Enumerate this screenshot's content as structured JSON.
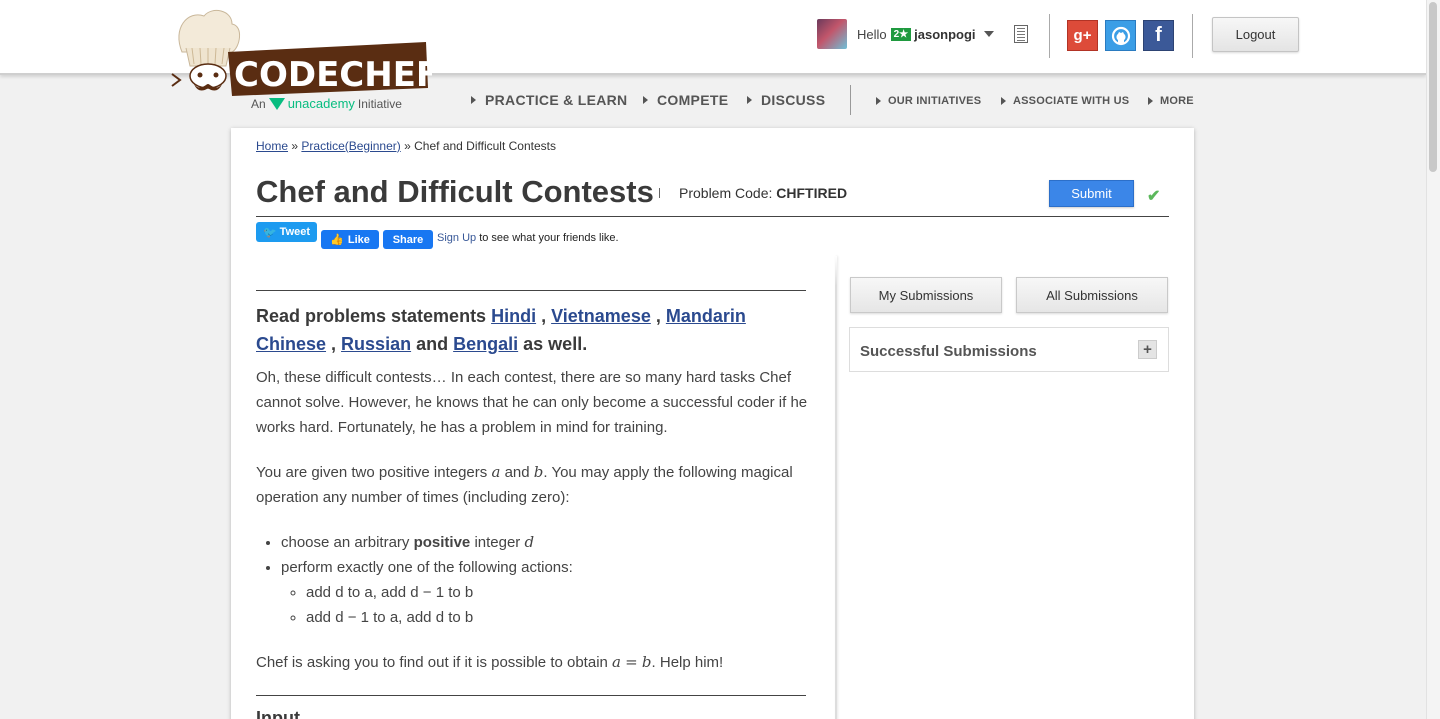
{
  "header": {
    "logo_text": "CODECHEF",
    "tagline_prefix": "An",
    "tagline_brand": "unacademy",
    "tagline_suffix": "Initiative",
    "greeting": "Hello",
    "star_badge": "2★",
    "username": "jasonpogi",
    "logout_label": "Logout",
    "social": [
      "google-plus-icon",
      "github-icon",
      "facebook-icon"
    ]
  },
  "nav": {
    "main": [
      "PRACTICE & LEARN",
      "COMPETE",
      "DISCUSS"
    ],
    "secondary": [
      "OUR INITIATIVES",
      "ASSOCIATE WITH US",
      "MORE"
    ]
  },
  "breadcrumb": {
    "home": "Home",
    "sep": "»",
    "practice": "Practice(Beginner)",
    "current": "Chef and Difficult Contests"
  },
  "problem": {
    "title": "Chef and Difficult Contests",
    "code_label": "Problem Code:",
    "code": "CHFTIRED",
    "submit_label": "Submit"
  },
  "share": {
    "tweet": "Tweet",
    "like": "Like",
    "share": "Share",
    "signup": "Sign Up",
    "signup_rest": "to see what your friends like."
  },
  "statement": {
    "read_prefix": "Read problems statements",
    "languages": [
      "Hindi",
      "Vietnamese",
      "Mandarin Chinese",
      "Russian",
      "Bengali"
    ],
    "and": "and",
    "read_suffix": "as well.",
    "para1": "Oh, these difficult contests… In each contest, there are so many hard tasks Chef cannot solve. However, he knows that he can only become a successful coder if he works hard. Fortunately, he has a problem in mind for training.",
    "para2_a": "You are given two positive integers",
    "para2_b": "and",
    "para2_c": ". You may apply the following magical operation any number of times (including zero):",
    "bullet1_a": "choose an arbitrary",
    "bullet1_b": "positive",
    "bullet1_c": "integer",
    "bullet2": "perform exactly one of the following actions:",
    "sub1": "add d to a, add d − 1 to b",
    "sub2": "add d − 1 to a, add d to b",
    "para3_a": "Chef is asking you to find out if it is possible to obtain",
    "para3_b": ". Help him!",
    "next_heading": "Input"
  },
  "sidebar": {
    "my_submissions": "My Submissions",
    "all_submissions": "All Submissions",
    "successful": "Successful Submissions",
    "expand": "+"
  },
  "colors": {
    "link": "#2b4a8f",
    "submit": "#3b86e8",
    "logo_brown": "#5a2d12"
  }
}
